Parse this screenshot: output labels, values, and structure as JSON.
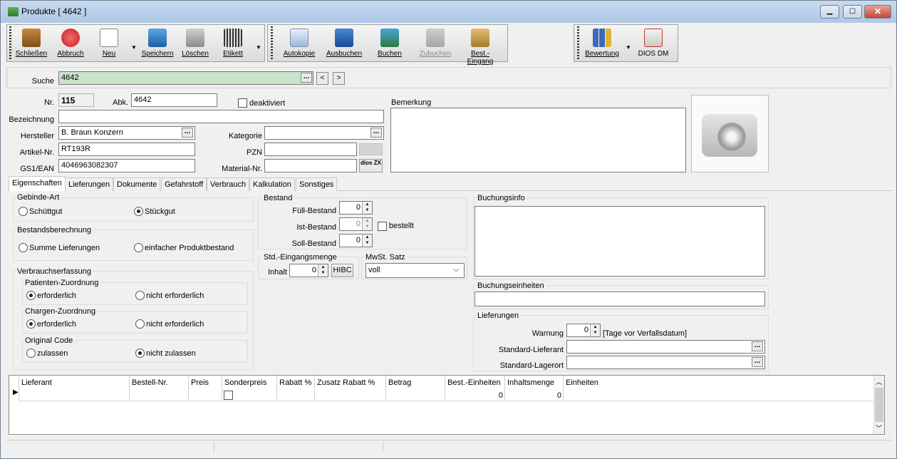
{
  "window": {
    "title": "Produkte [ 4642 ]"
  },
  "toolbar": {
    "schliessen": "Schließen",
    "abbruch": "Abbruch",
    "neu": "Neu",
    "speichern": "Speichern",
    "loeschen": "Löschen",
    "etikett": "Etikett",
    "autokopie": "Autokopie",
    "ausbuchen": "Ausbuchen",
    "buchen": "Buchen",
    "zubuchen": "Zubuchen",
    "best_eingang": "Best.-Eingang",
    "bewertung": "Bewertung",
    "dios_dm": "DIOS DM"
  },
  "search": {
    "label": "Suche",
    "value": "4642",
    "prev": "<",
    "next": ">"
  },
  "form": {
    "nr_label": "Nr.",
    "nr_value": "115",
    "abk_label": "Abk.",
    "abk_value": "4642",
    "deaktiviert": "deaktiviert",
    "bezeichnung_label": "Bezeichnung",
    "bezeichnung_value": "",
    "hersteller_label": "Hersteller",
    "hersteller_value": "B. Braun Konzern",
    "artikel_label": "Artikel-Nr.",
    "artikel_value": "RT193R",
    "gs1_label": "GS1/EAN",
    "gs1_value": "4046963082307",
    "kategorie_label": "Kategorie",
    "pzn_label": "PZN",
    "material_label": "Material-Nr.",
    "bemerkung_label": "Bemerkung",
    "dios_zx": "dios ZX"
  },
  "tabs": [
    "Eigenschaften",
    "Lieferungen",
    "Dokumente",
    "Gefahrstoff",
    "Verbrauch",
    "Kalkulation",
    "Sonstiges"
  ],
  "props": {
    "gebinde_title": "Gebinde-Art",
    "schuettgut": "Schüttgut",
    "stueckgut": "Stückgut",
    "bestandsber_title": "Bestandsberechnung",
    "summe": "Summe Lieferungen",
    "einfacher": "einfacher Produktbestand",
    "verbrauch_title": "Verbrauchserfassung",
    "patienten_title": "Patienten-Zuordnung",
    "chargen_title": "Chargen-Zuordnung",
    "original_title": "Original Code",
    "erforderlich": "erforderlich",
    "nicht_erforderlich": "nicht erforderlich",
    "zulassen": "zulassen",
    "nicht_zulassen": "nicht zulassen"
  },
  "bestand": {
    "title": "Bestand",
    "fuell": "Füll-Bestand",
    "fuell_v": "0",
    "ist": "Ist-Bestand",
    "ist_v": "0",
    "bestellt": "bestellt",
    "soll": "Soll-Bestand",
    "soll_v": "0"
  },
  "std": {
    "title": "Std.-Eingangsmenge",
    "inhalt": "Inhalt",
    "inhalt_v": "0",
    "hibc": "HIBC"
  },
  "mwst": {
    "title": "MwSt. Satz",
    "value": "voll"
  },
  "buchung": {
    "info": "Buchungsinfo",
    "einheiten": "Buchungseinheiten"
  },
  "lieferungen": {
    "title": "Lieferungen",
    "warnung": "Warnung",
    "warnung_v": "0",
    "tage": "[Tage vor Verfallsdatum]",
    "std_lieferant": "Standard-Lieferant",
    "std_lagerort": "Standard-Lagerort"
  },
  "grid": {
    "headers": [
      "Lieferant",
      "Bestell-Nr.",
      "Preis",
      "Sonderpreis",
      "Rabatt %",
      "Zusatz Rabatt %",
      "Betrag",
      "Best.-Einheiten",
      "Inhaltsmenge",
      "Einheiten"
    ],
    "row": {
      "best_einheiten": "0",
      "inhaltsmenge": "0"
    }
  }
}
